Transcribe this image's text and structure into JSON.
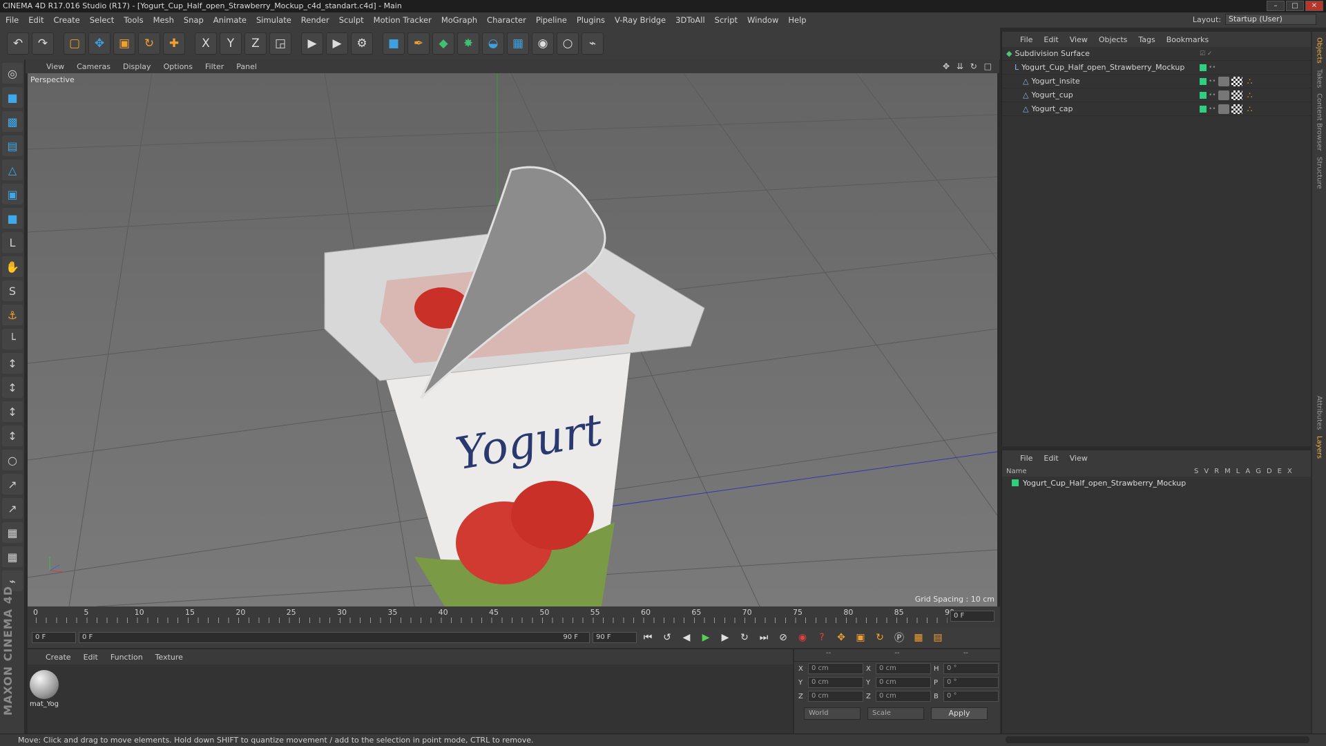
{
  "window": {
    "title": "CINEMA 4D R17.016 Studio (R17) - [Yogurt_Cup_Half_open_Strawberry_Mockup_c4d_standart.c4d] - Main",
    "min": "–",
    "max": "□",
    "close": "✕"
  },
  "menu": [
    "File",
    "Edit",
    "Create",
    "Select",
    "Tools",
    "Mesh",
    "Snap",
    "Animate",
    "Simulate",
    "Render",
    "Sculpt",
    "Motion Tracker",
    "MoGraph",
    "Character",
    "Pipeline",
    "Plugins",
    "V-Ray Bridge",
    "3DToAll",
    "Script",
    "Window",
    "Help"
  ],
  "layout": {
    "label": "Layout:",
    "value": "Startup (User)"
  },
  "toolbar": {
    "icons": [
      "undo-icon",
      "redo-icon",
      "live-selection-icon",
      "move-icon",
      "scale-icon",
      "rotate-icon",
      "last-tool-icon",
      "x-axis-icon",
      "y-axis-icon",
      "z-axis-icon",
      "coordinate-system-icon",
      "render-view-icon",
      "render-picture-viewer-icon",
      "edit-render-settings-icon",
      "cube-icon",
      "pen-spline-icon",
      "subdivision-icon",
      "cloner-icon",
      "deformer-icon",
      "floor-icon",
      "camera-icon",
      "light-icon",
      "python-icon"
    ],
    "glyphs": [
      "↶",
      "↷",
      "▢",
      "✥",
      "▣",
      "↻",
      "✚",
      "X",
      "Y",
      "Z",
      "◲",
      "▶",
      "▶",
      "⚙",
      "■",
      "✒",
      "◆",
      "✸",
      "◒",
      "▦",
      "◉",
      "○",
      "⌁"
    ]
  },
  "left_tools": [
    "◎",
    "■",
    "▩",
    "▤",
    "△",
    "▣",
    "■",
    "L",
    "✋",
    "S",
    "⚓",
    "└",
    "↕",
    "↕",
    "↕",
    "↕",
    "○",
    "↗",
    "↗",
    "▦",
    "▦",
    "⌁"
  ],
  "maxon": "MAXON CINEMA 4D",
  "viewport": {
    "menu": [
      "View",
      "Cameras",
      "Display",
      "Options",
      "Filter",
      "Panel"
    ],
    "label": "Perspective",
    "grid_spacing": "Grid Spacing : 10 cm",
    "nav_icons": "✥ ⇊ ↻ □",
    "axis_x": "X",
    "axis_y": "Y",
    "axis_z": "Z"
  },
  "timeline": {
    "ticks": [
      "0",
      "5",
      "10",
      "15",
      "20",
      "25",
      "30",
      "35",
      "40",
      "45",
      "50",
      "55",
      "60",
      "65",
      "70",
      "75",
      "80",
      "85",
      "90"
    ],
    "current": "0 F"
  },
  "playback": {
    "start": "0 F",
    "range_start": "0 F",
    "range_end": "90 F",
    "end": "90 F"
  },
  "material_manager": {
    "menu": [
      "Create",
      "Edit",
      "Function",
      "Texture"
    ],
    "materials": [
      {
        "name": "mat_Yog"
      }
    ]
  },
  "coordinates": {
    "headers": [
      "--",
      "--",
      "--"
    ],
    "rows": [
      {
        "a": "X",
        "v1": "0 cm",
        "b": "X",
        "v2": "0 cm",
        "c": "H",
        "v3": "0 °"
      },
      {
        "a": "Y",
        "v1": "0 cm",
        "b": "Y",
        "v2": "0 cm",
        "c": "P",
        "v3": "0 °"
      },
      {
        "a": "Z",
        "v1": "0 cm",
        "b": "Z",
        "v2": "0 cm",
        "c": "B",
        "v3": "0 °"
      }
    ],
    "mode1": "World",
    "mode2": "Scale",
    "apply": "Apply"
  },
  "object_manager": {
    "menu": [
      "File",
      "Edit",
      "View",
      "Objects",
      "Tags",
      "Bookmarks"
    ],
    "objects": [
      {
        "name": "Subdivision Surface",
        "indent": 0
      },
      {
        "name": "Yogurt_Cup_Half_open_Strawberry_Mockup",
        "indent": 1
      },
      {
        "name": "Yogurt_insite",
        "indent": 2
      },
      {
        "name": "Yogurt_cup",
        "indent": 2
      },
      {
        "name": "Yogurt_cap",
        "indent": 2
      }
    ]
  },
  "layers_manager": {
    "menu": [
      "File",
      "Edit",
      "View"
    ],
    "col_name": "Name",
    "cols": [
      "S",
      "V",
      "R",
      "M",
      "L",
      "A",
      "G",
      "D",
      "E",
      "X"
    ],
    "layers": [
      {
        "name": "Yogurt_Cup_Half_open_Strawberry_Mockup",
        "color": "#2fcf7f"
      }
    ]
  },
  "side_tabs": [
    "Objects",
    "Takes",
    "Content Browser",
    "Structure",
    "Attributes",
    "Layers"
  ],
  "status": "Move: Click and drag to move elements. Hold down SHIFT to quantize movement / add to the selection in point mode, CTRL to remove."
}
